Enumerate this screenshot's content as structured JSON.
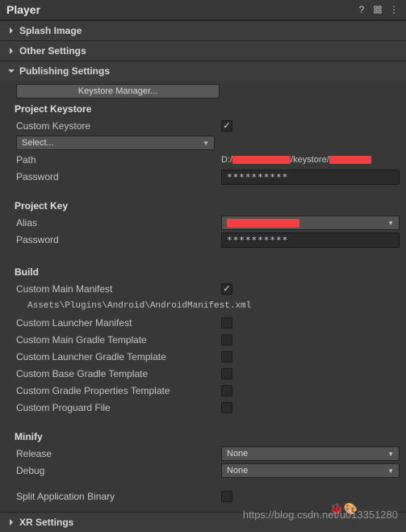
{
  "header": {
    "title": "Player"
  },
  "sections": {
    "splash": {
      "title": "Splash Image"
    },
    "other": {
      "title": "Other Settings"
    },
    "publishing": {
      "title": "Publishing Settings"
    },
    "xr": {
      "title": "XR Settings"
    }
  },
  "publishing": {
    "keystore_manager_btn": "Keystore Manager...",
    "project_keystore_title": "Project Keystore",
    "custom_keystore_label": "Custom Keystore",
    "select_label": "Select...",
    "path_label": "Path",
    "path_value_prefix": "D:/",
    "path_value_mid": "/keystore/",
    "password_label": "Password",
    "password_value": "**********",
    "project_key_title": "Project Key",
    "alias_label": "Alias",
    "key_password_label": "Password",
    "key_password_value": "**********",
    "build_title": "Build",
    "custom_main_manifest_label": "Custom Main Manifest",
    "manifest_path": "Assets\\Plugins\\Android\\AndroidManifest.xml",
    "custom_launcher_manifest_label": "Custom Launcher Manifest",
    "custom_main_gradle_label": "Custom Main Gradle Template",
    "custom_launcher_gradle_label": "Custom Launcher Gradle Template",
    "custom_base_gradle_label": "Custom Base Gradle Template",
    "custom_gradle_props_label": "Custom Gradle Properties Template",
    "custom_proguard_label": "Custom Proguard File",
    "minify_title": "Minify",
    "release_label": "Release",
    "release_value": "None",
    "debug_label": "Debug",
    "debug_value": "None",
    "split_binary_label": "Split Application Binary"
  },
  "watermark": "https://blog.csdn.net/u013351280"
}
